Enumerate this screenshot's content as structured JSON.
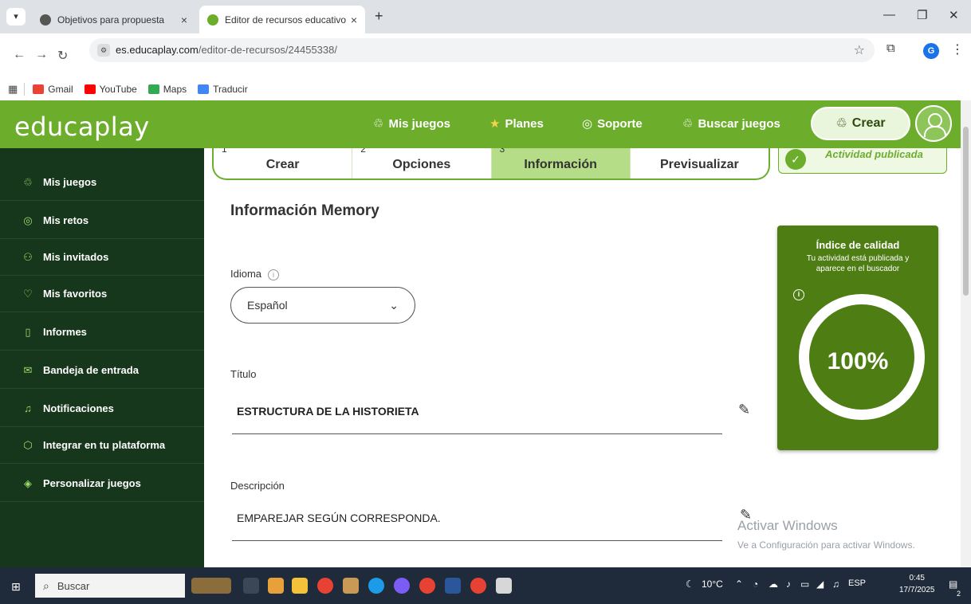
{
  "browser": {
    "tabs": [
      {
        "title": "Objetivos para propuesta",
        "active": false
      },
      {
        "title": "Editor de recursos educativos: E",
        "active": true
      }
    ],
    "url_domain": "es.educaplay.com",
    "url_path": "/editor-de-recursos/24455338/",
    "profile_initial": "G",
    "bookmarks": [
      "Gmail",
      "YouTube",
      "Maps",
      "Traducir"
    ]
  },
  "header": {
    "logo": "educaplay",
    "nav": [
      {
        "label": "Mis juegos",
        "icon": "puzzle-icon"
      },
      {
        "label": "Planes",
        "icon": "star-icon"
      },
      {
        "label": "Soporte",
        "icon": "support-icon"
      },
      {
        "label": "Buscar juegos",
        "icon": "search-puzzle-icon"
      }
    ],
    "create_label": "Crear"
  },
  "sidebar": {
    "items": [
      {
        "label": "Mis juegos",
        "icon": "puzzle-icon"
      },
      {
        "label": "Mis retos",
        "icon": "target-icon"
      },
      {
        "label": "Mis invitados",
        "icon": "users-icon"
      },
      {
        "label": "Mis favoritos",
        "icon": "heart-icon"
      },
      {
        "label": "Informes",
        "icon": "clipboard-icon"
      },
      {
        "label": "Bandeja de entrada",
        "icon": "mail-icon"
      },
      {
        "label": "Notificaciones",
        "icon": "bell-icon"
      },
      {
        "label": "Integrar en tu plataforma",
        "icon": "cube-icon"
      },
      {
        "label": "Personalizar juegos",
        "icon": "paint-icon"
      }
    ]
  },
  "steps": [
    {
      "num": "1",
      "label": "Crear"
    },
    {
      "num": "2",
      "label": "Opciones"
    },
    {
      "num": "3",
      "label": "Información"
    },
    {
      "num": "",
      "label": "Previsualizar"
    }
  ],
  "published_label": "Actividad publicada",
  "form": {
    "section_title": "Información Memory",
    "language_label": "Idioma",
    "language_value": "Español",
    "title_label": "Título",
    "title_value": "ESTRUCTURA DE LA HISTORIETA",
    "description_label": "Descripción",
    "description_value": "EMPAREJAR SEGÚN CORRESPONDA."
  },
  "quality": {
    "title": "Índice de calidad",
    "subtitle": "Tu actividad está publicada y aparece en el buscador",
    "percent": "100%"
  },
  "watermark": {
    "line1": "Activar Windows",
    "line2": "Ve a Configuración para activar Windows."
  },
  "taskbar": {
    "search_placeholder": "Buscar",
    "weather": "10°C",
    "lang": "ESP",
    "time": "0:45",
    "date": "17/7/2025",
    "notif_count": "2"
  },
  "colors": {
    "brand_green": "#6cae2c",
    "sidebar_dark": "#17371c",
    "quality_green": "#4e7d14"
  }
}
